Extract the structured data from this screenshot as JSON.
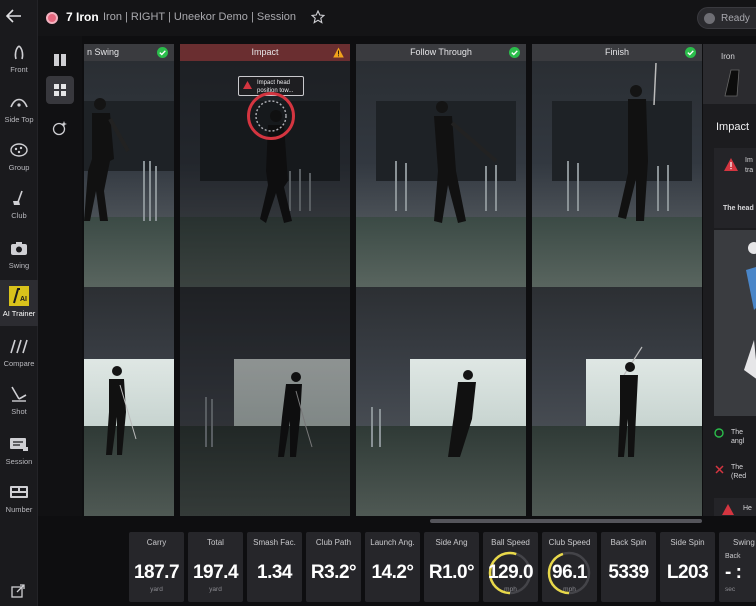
{
  "topbar": {
    "club": "7 Iron",
    "subtitle": "Iron | RIGHT | Uneekor Demo | Session",
    "ready_label": "Ready"
  },
  "sidebar": {
    "items": [
      {
        "label": "Front",
        "icon": "front-view-icon"
      },
      {
        "label": "Side Top",
        "icon": "side-top-view-icon"
      },
      {
        "label": "Group",
        "icon": "group-icon"
      },
      {
        "label": "Club",
        "icon": "club-icon"
      },
      {
        "label": "Swing",
        "icon": "camera-icon"
      },
      {
        "label": "AI Trainer",
        "icon": "ai-trainer-icon",
        "active": true
      },
      {
        "label": "Compare",
        "icon": "compare-icon"
      },
      {
        "label": "Shot",
        "icon": "shot-icon"
      },
      {
        "label": "Session",
        "icon": "session-icon"
      },
      {
        "label": "Number",
        "icon": "number-icon"
      }
    ]
  },
  "frames": [
    {
      "label": "n Swing",
      "status": "ok"
    },
    {
      "label": "Impact",
      "status": "warning"
    },
    {
      "label": "Follow Through",
      "status": "ok"
    },
    {
      "label": "Finish",
      "status": "ok"
    }
  ],
  "impact_overlay": {
    "line1": "Impact head",
    "line2": "position tow..."
  },
  "right_panel": {
    "club_tab": "Iron",
    "title": "Impact",
    "card_lines": [
      "Im",
      "tra"
    ],
    "desc": "The head",
    "check1": [
      "The",
      "angl"
    ],
    "check2": [
      "The",
      "(Red"
    ],
    "bottom": "He"
  },
  "metrics": [
    {
      "label": "Carry",
      "value": "187.7",
      "unit": "yard"
    },
    {
      "label": "Total",
      "value": "197.4",
      "unit": "yard"
    },
    {
      "label": "Smash Fac.",
      "value": "1.34",
      "unit": ""
    },
    {
      "label": "Club Path",
      "value": "R3.2°",
      "unit": ""
    },
    {
      "label": "Launch Ang.",
      "value": "14.2°",
      "unit": ""
    },
    {
      "label": "Side Ang",
      "value": "R1.0°",
      "unit": ""
    },
    {
      "label": "Ball Speed",
      "value": "129.0",
      "unit": "mph",
      "ring": 0.55
    },
    {
      "label": "Club Speed",
      "value": "96.1",
      "unit": "mph",
      "ring": 0.45
    },
    {
      "label": "Back Spin",
      "value": "5339",
      "unit": ""
    },
    {
      "label": "Side Spin",
      "value": "L203",
      "unit": ""
    },
    {
      "label": "Swing",
      "sub": "Back",
      "value": "- :",
      "unit": "sec"
    }
  ],
  "colors": {
    "ok": "#2bbd4b",
    "warning": "#f1a21c",
    "alert_red": "#d43540",
    "ring_yellow": "#e8d84a"
  }
}
